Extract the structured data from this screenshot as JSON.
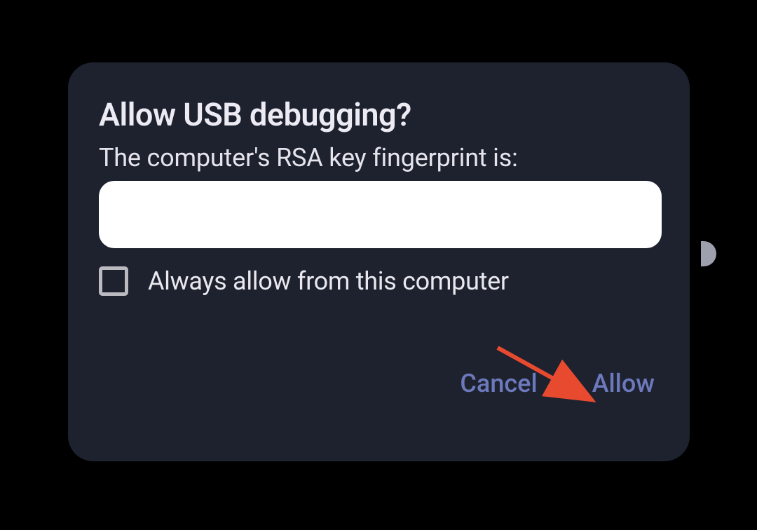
{
  "dialog": {
    "title": "Allow USB debugging?",
    "subtitle": "The computer's RSA key fingerprint is:",
    "fingerprint_value": "",
    "checkbox_label": "Always allow from this computer",
    "cancel_label": "Cancel",
    "allow_label": "Allow"
  },
  "colors": {
    "dialog_bg": "#1e222e",
    "accent": "#6c79bc",
    "text_primary": "#eceaf3",
    "arrow": "#e84a2f"
  }
}
